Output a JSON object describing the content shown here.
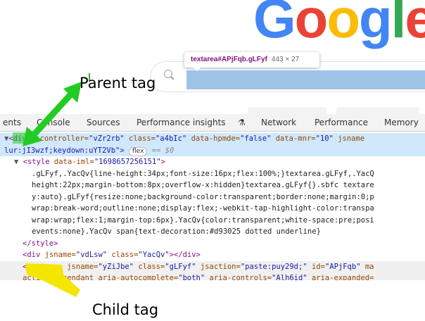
{
  "logo": {
    "letters": [
      "G",
      "o",
      "o",
      "g",
      "l",
      "e"
    ]
  },
  "tooltip": {
    "selector": "textarea#APjFqb.gLFyf",
    "dimensions": "443 × 27"
  },
  "annotations": {
    "parent_label": "Parent tag",
    "child_label": "Child tag"
  },
  "devtools": {
    "tabs": [
      "ents",
      "Console",
      "Sources",
      "Performance insights",
      "Network",
      "Performance",
      "Memory"
    ],
    "lines": {
      "l1a": "<div",
      "l1b": " jscontroller=",
      "l1c": "\"vZr2rb\"",
      "l1d": " class=",
      "l1e": "\"a4bIc\"",
      "l1f": " data-hpmde=",
      "l1g": "\"false\"",
      "l1h": " data-mnr=",
      "l1i": "\"10\"",
      "l1j": " jsname",
      "l2a": "lur:jI3wzf;keydown:uYT2Vb\">",
      "l2badge": "flex",
      "l2c": "== $0",
      "l3a": "<style",
      "l3b": " data-iml=",
      "l3c": "\"1698657256151\"",
      "l3d": ">",
      "css1": ".gLFyf,.YacQv{line-height:34px;font-size:16px;flex:100%;}textarea.gLFyf,.YacQ",
      "css2": "height:22px;margin-bottom:8px;overflow-x:hidden}textarea.gLFyf{}.sbfc textare",
      "css3": "y:auto}.gLFyf{resize:none;background-color:transparent;border:none;margin:0;p",
      "css4": "wrap:break-word;outline:none;display:flex;-webkit-tap-highlight-color:transpa",
      "css5": "wrap:wrap;flex:1;margin-top:6px}.YacQv{color:transparent;white-space:pre;posi",
      "css6": "events:none}.YacQv span{text-decoration:#d93025 dotted underline}",
      "l4": "</style>",
      "l5a": "<div",
      "l5b": " jsname=",
      "l5c": "\"vdLsw\"",
      "l5d": " class=",
      "l5e": "\"YacQv\"",
      "l5f": "></div>",
      "l6a": "<textarea",
      "l6b": " jsname=",
      "l6c": "\"yZiJbe\"",
      "l6d": " class=",
      "l6e": "\"gLFyf\"",
      "l6f": " jsaction=",
      "l6g": "\"paste:puy29d;\"",
      "l6h": " id=",
      "l6i": "\"APjFqb\"",
      "l6j": " ma",
      "l7a": "activedescendant",
      "l7b": " aria-autocomplete=",
      "l7c": "\"both\"",
      "l7d": " aria-controls=",
      "l7e": "\"Alh6id\"",
      "l7f": " aria-expanded="
    }
  },
  "colors": {
    "google_blue": "#4285f4",
    "google_red": "#ea4335",
    "google_yellow": "#fbbc05",
    "google_green": "#34a853",
    "highlight": "#a0c3e8",
    "annotation_green": "#22cc22",
    "annotation_yellow": "#f5e600"
  }
}
